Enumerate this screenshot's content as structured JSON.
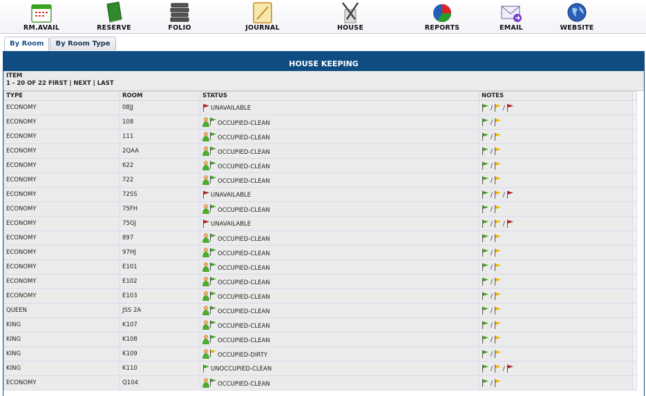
{
  "toolbar": [
    {
      "label": "RM.AVAIL",
      "icon": "calendar-icon"
    },
    {
      "label": "RESERVE",
      "icon": "book-icon"
    },
    {
      "label": "FOLIO",
      "icon": "folio-stack-icon"
    },
    {
      "label": "JOURNAL",
      "icon": "notepad-icon"
    },
    {
      "label": "HOUSE",
      "icon": "cleaning-tools-icon"
    },
    {
      "label": "REPORTS",
      "icon": "pie-chart-icon"
    },
    {
      "label": "EMAIL",
      "icon": "envelope-icon"
    },
    {
      "label": "WEBSITE",
      "icon": "globe-icon"
    }
  ],
  "tabs": [
    {
      "label": "By Room",
      "active": true
    },
    {
      "label": "By Room Type",
      "active": false
    }
  ],
  "panel": {
    "title": "HOUSE KEEPING"
  },
  "pager": {
    "item_label": "ITEM",
    "range": "1 - 20 OF 22",
    "first": "FIRST",
    "next": "NEXT",
    "last": "LAST",
    "sep": "|"
  },
  "table": {
    "headers": [
      "TYPE",
      "ROOM",
      "STATUS",
      "NOTES"
    ],
    "rows": [
      {
        "type": "ECONOMY",
        "room": "08JJ",
        "status": "UNAVAILABLE",
        "person": false,
        "flag": "red",
        "notes": [
          "green",
          "yellow",
          "red"
        ]
      },
      {
        "type": "ECONOMY",
        "room": "108",
        "status": "OCCUPIED-CLEAN",
        "person": true,
        "flag": "green",
        "notes": [
          "green",
          "yellow"
        ]
      },
      {
        "type": "ECONOMY",
        "room": "111",
        "status": "OCCUPIED-CLEAN",
        "person": true,
        "flag": "green",
        "notes": [
          "green",
          "yellow"
        ]
      },
      {
        "type": "ECONOMY",
        "room": "2QAA",
        "status": "OCCUPIED-CLEAN",
        "person": true,
        "flag": "green",
        "notes": [
          "green",
          "yellow"
        ]
      },
      {
        "type": "ECONOMY",
        "room": "622",
        "status": "OCCUPIED-CLEAN",
        "person": true,
        "flag": "green",
        "notes": [
          "green",
          "yellow"
        ]
      },
      {
        "type": "ECONOMY",
        "room": "722",
        "status": "OCCUPIED-CLEAN",
        "person": true,
        "flag": "green",
        "notes": [
          "green",
          "yellow"
        ]
      },
      {
        "type": "ECONOMY",
        "room": "72SS",
        "status": "UNAVAILABLE",
        "person": false,
        "flag": "red",
        "notes": [
          "green",
          "yellow",
          "red"
        ]
      },
      {
        "type": "ECONOMY",
        "room": "75FH",
        "status": "OCCUPIED-CLEAN",
        "person": true,
        "flag": "green",
        "notes": [
          "green",
          "yellow"
        ]
      },
      {
        "type": "ECONOMY",
        "room": "75GJ",
        "status": "UNAVAILABLE",
        "person": false,
        "flag": "red",
        "notes": [
          "green",
          "yellow",
          "red"
        ]
      },
      {
        "type": "ECONOMY",
        "room": "897",
        "status": "OCCUPIED-CLEAN",
        "person": true,
        "flag": "green",
        "notes": [
          "green",
          "yellow"
        ]
      },
      {
        "type": "ECONOMY",
        "room": "97HJ",
        "status": "OCCUPIED-CLEAN",
        "person": true,
        "flag": "green",
        "notes": [
          "green",
          "yellow"
        ]
      },
      {
        "type": "ECONOMY",
        "room": "E101",
        "status": "OCCUPIED-CLEAN",
        "person": true,
        "flag": "green",
        "notes": [
          "green",
          "yellow"
        ]
      },
      {
        "type": "ECONOMY",
        "room": "E102",
        "status": "OCCUPIED-CLEAN",
        "person": true,
        "flag": "green",
        "notes": [
          "green",
          "yellow"
        ]
      },
      {
        "type": "ECONOMY",
        "room": "E103",
        "status": "OCCUPIED-CLEAN",
        "person": true,
        "flag": "green",
        "notes": [
          "green",
          "yellow"
        ]
      },
      {
        "type": "QUEEN",
        "room": "JSS 2A",
        "status": "OCCUPIED-CLEAN",
        "person": true,
        "flag": "green",
        "notes": [
          "green",
          "yellow"
        ]
      },
      {
        "type": "KING",
        "room": "K107",
        "status": "OCCUPIED-CLEAN",
        "person": true,
        "flag": "green",
        "notes": [
          "green",
          "yellow"
        ]
      },
      {
        "type": "KING",
        "room": "K108",
        "status": "OCCUPIED-CLEAN",
        "person": true,
        "flag": "green",
        "notes": [
          "green",
          "yellow"
        ]
      },
      {
        "type": "KING",
        "room": "K109",
        "status": "OCCUPIED-DIRTY",
        "person": true,
        "flag": "yellow",
        "notes": [
          "green",
          "yellow"
        ]
      },
      {
        "type": "KING",
        "room": "K110",
        "status": "UNOCCUPIED-CLEAN",
        "person": false,
        "flag": "green",
        "notes": [
          "green",
          "yellow",
          "red"
        ]
      },
      {
        "type": "ECONOMY",
        "room": "Q104",
        "status": "OCCUPIED-CLEAN",
        "person": true,
        "flag": "green",
        "notes": [
          "green",
          "yellow"
        ]
      }
    ]
  },
  "colors": {
    "header_blue": "#0f4c82",
    "flag_green": "#3aa21e",
    "flag_yellow": "#e6b800",
    "flag_red": "#b3202a",
    "person_green": "#4caf2a",
    "person_skin": "#f0b070"
  }
}
